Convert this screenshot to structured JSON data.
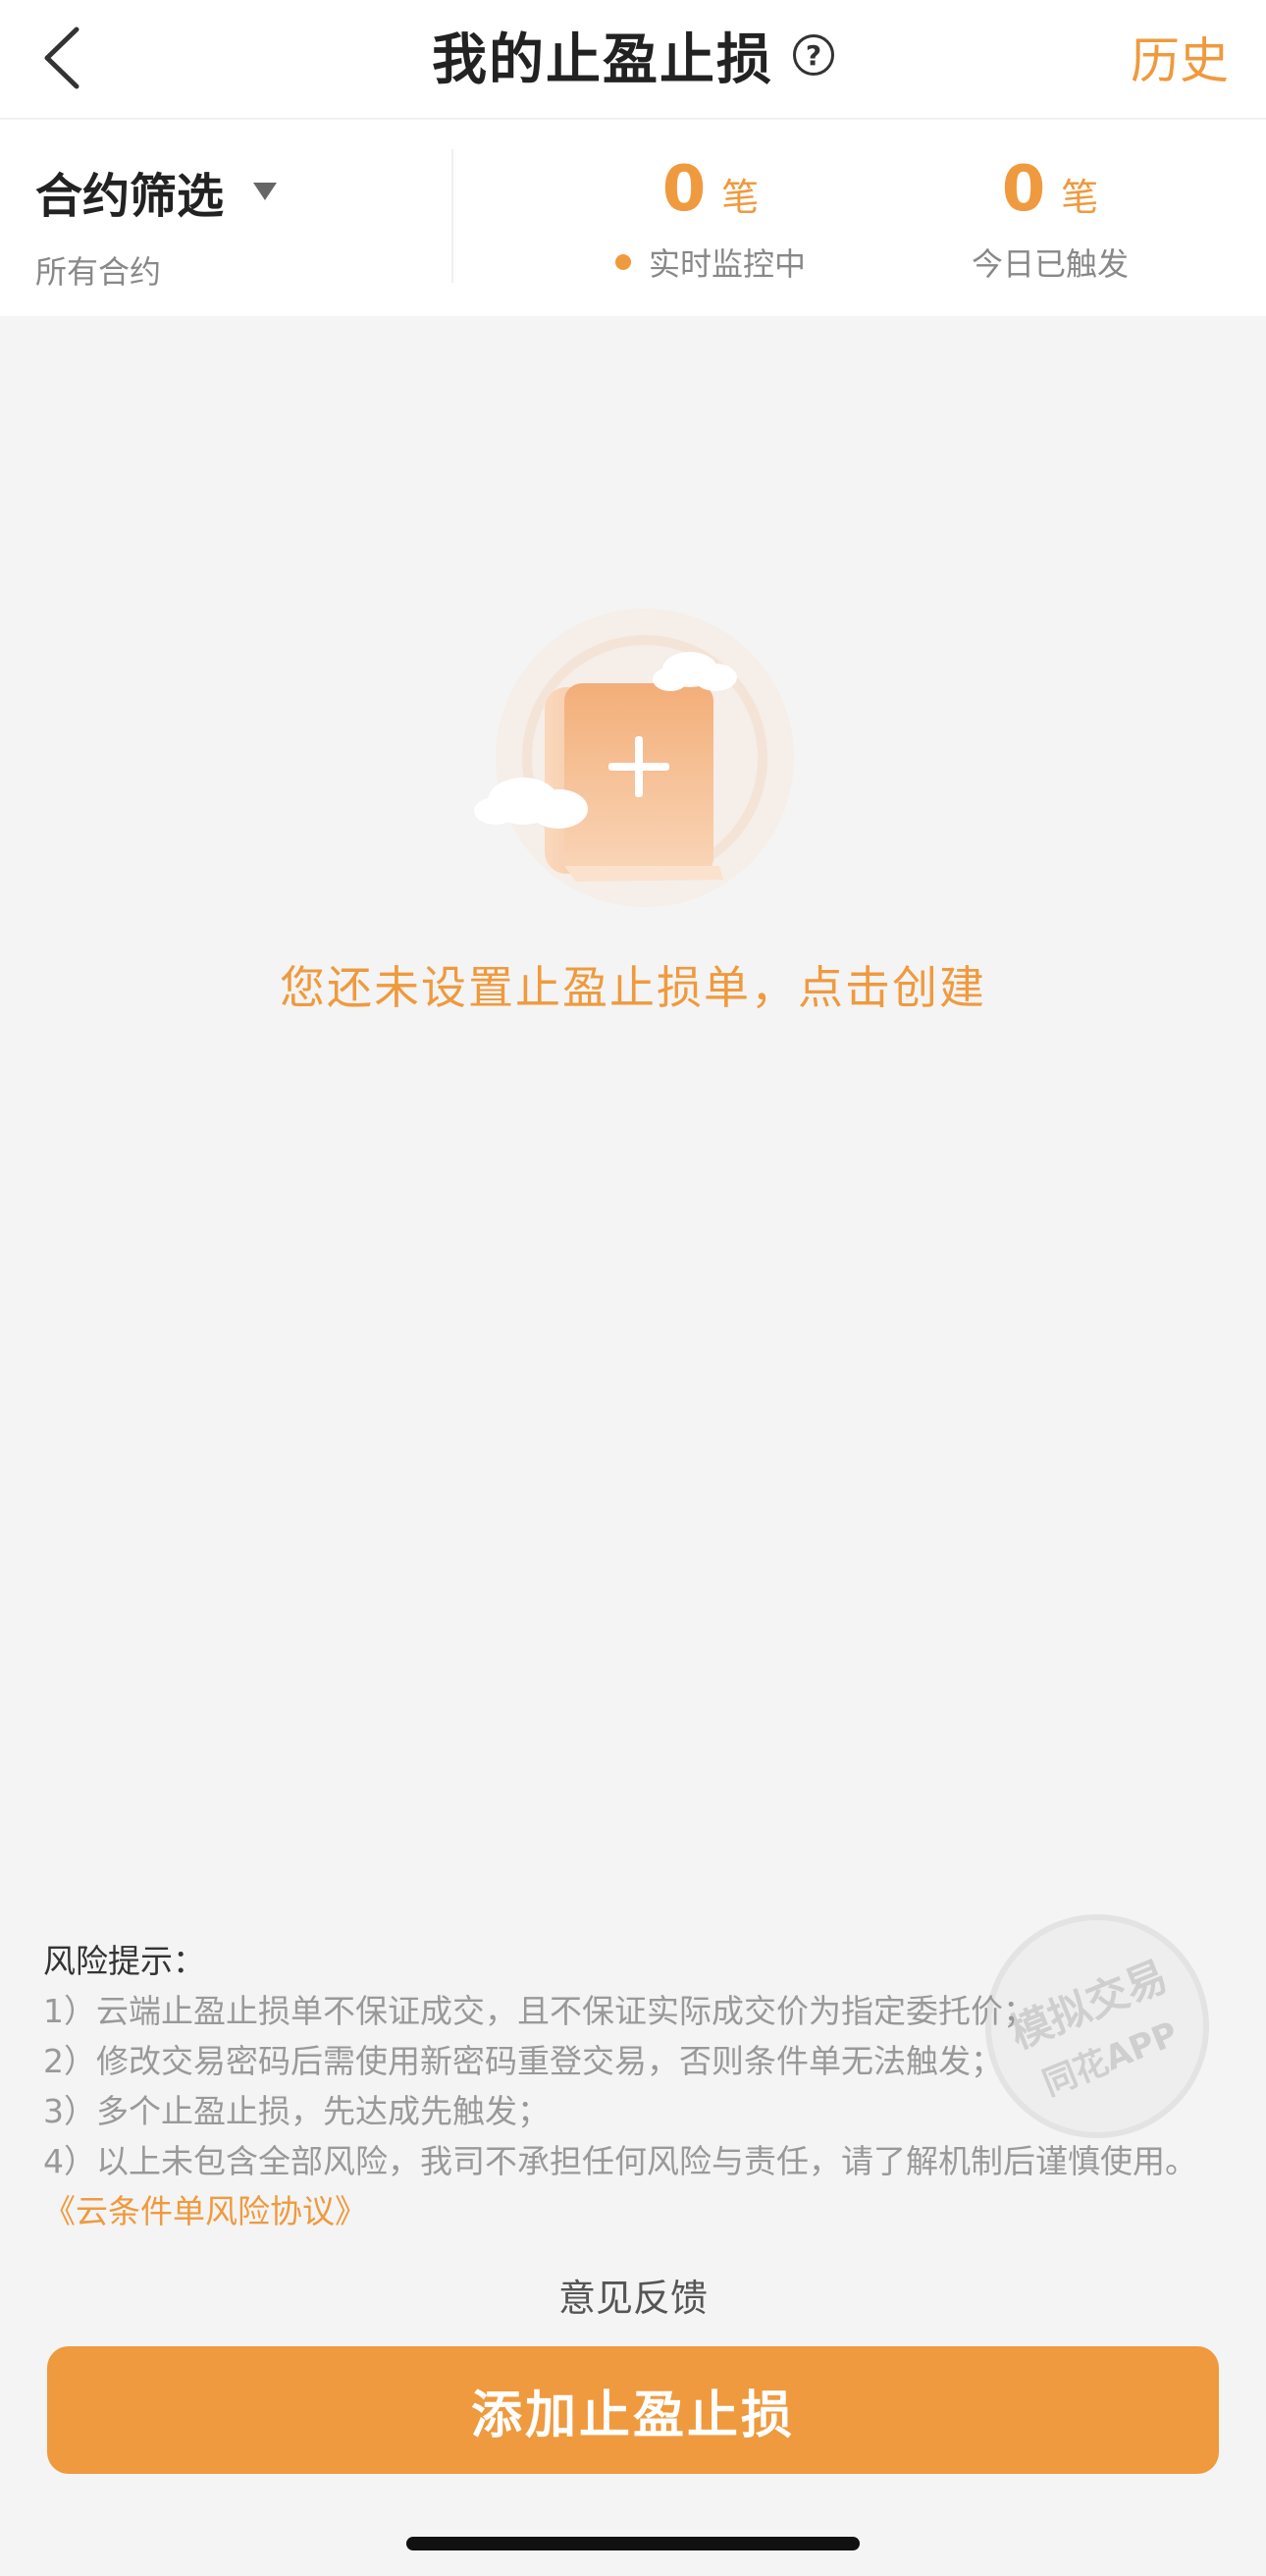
{
  "nav": {
    "title": "我的止盈止损",
    "help_glyph": "?",
    "history_label": "历史"
  },
  "filter": {
    "title": "合约筛选",
    "subtitle": "所有合约"
  },
  "stats": [
    {
      "count": "0",
      "unit": "笔",
      "label": "实时监控中"
    },
    {
      "count": "0",
      "unit": "笔",
      "label": "今日已触发"
    }
  ],
  "empty_state": {
    "icon": "scroll-plus-icon",
    "text": "您还未设置止盈止损单，点击创建"
  },
  "risk": {
    "title": "风险提示：",
    "items": [
      "1）云端止盈止损单不保证成交，且不保证实际成交价为指定委托价；",
      "2）修改交易密码后需使用新密码重登交易，否则条件单无法触发；",
      "3）多个止盈止损，先达成先触发；",
      "4）以上未包含全部风险，我司不承担任何风险与责任，请了解机制后谨慎使用。"
    ],
    "link": "《云条件单风险协议》"
  },
  "watermark": {
    "line1": "模拟交易",
    "line2": "同花APP"
  },
  "feedback_label": "意见反馈",
  "add_button_label": "添加止盈止损",
  "colors": {
    "accent": "#ef9a3e",
    "background": "#f4f4f4"
  }
}
